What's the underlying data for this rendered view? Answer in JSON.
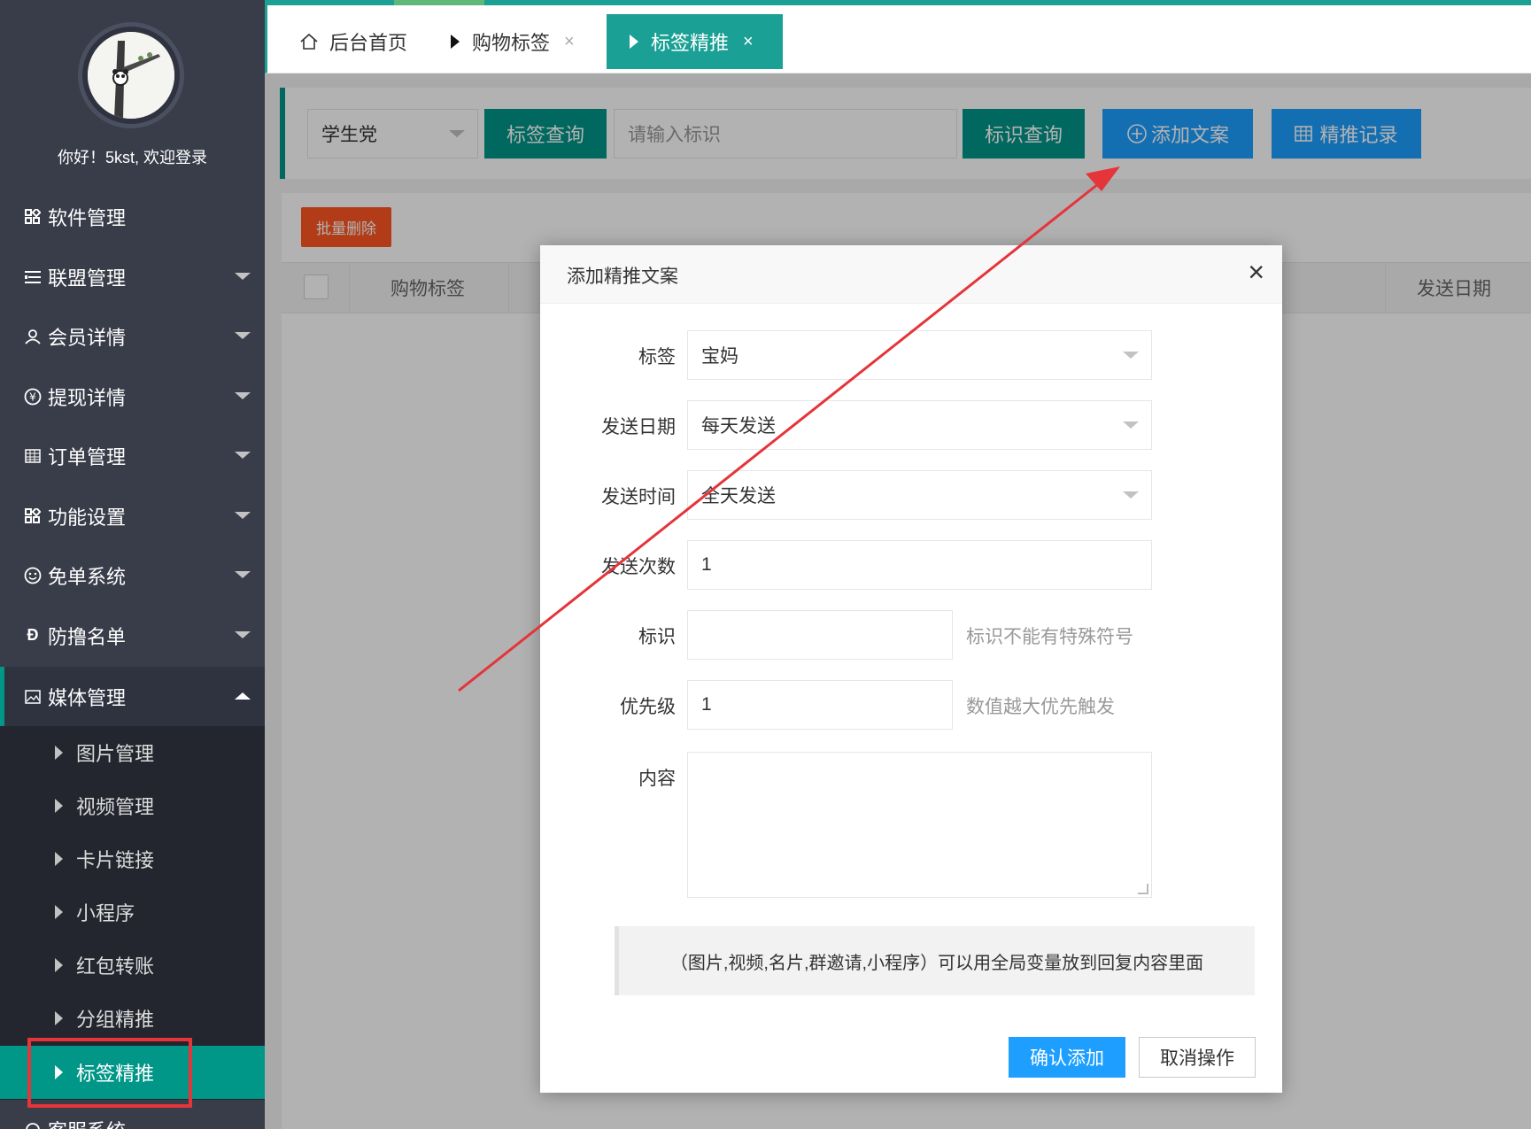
{
  "sidebar": {
    "welcome": "你好！5kst, 欢迎登录",
    "items": [
      {
        "label": "软件管理",
        "icon": "grid-icon"
      },
      {
        "label": "联盟管理",
        "icon": "list-icon"
      },
      {
        "label": "会员详情",
        "icon": "user-icon"
      },
      {
        "label": "提现详情",
        "icon": "yen-icon"
      },
      {
        "label": "订单管理",
        "icon": "table-icon"
      },
      {
        "label": "功能设置",
        "icon": "grid-icon"
      },
      {
        "label": "免单系统",
        "icon": "face-icon"
      },
      {
        "label": "防撸名单",
        "icon": "dong-icon"
      },
      {
        "label": "媒体管理",
        "icon": "picture-icon"
      }
    ],
    "submenu": [
      {
        "label": "图片管理"
      },
      {
        "label": "视频管理"
      },
      {
        "label": "卡片链接"
      },
      {
        "label": "小程序"
      },
      {
        "label": "红包转账"
      },
      {
        "label": "分组精推"
      },
      {
        "label": "标签精推"
      }
    ],
    "last_item": "客服系统"
  },
  "tabs": [
    {
      "label": "后台首页",
      "icon": "home-icon"
    },
    {
      "label": "购物标签",
      "close": "×"
    },
    {
      "label": "标签精推",
      "close": "×"
    }
  ],
  "search": {
    "select_value": "学生党",
    "tag_query": "标签查询",
    "id_placeholder": "请输入标识",
    "id_query": "标识查询",
    "add_copy": "添加文案",
    "records": "精推记录"
  },
  "table": {
    "batch_delete": "批量删除",
    "headers": [
      "购物标签",
      "发送日期"
    ]
  },
  "modal": {
    "title": "添加精推文案",
    "close": "×",
    "fields": {
      "tag_label": "标签",
      "tag_value": "宝妈",
      "date_label": "发送日期",
      "date_value": "每天发送",
      "time_label": "发送时间",
      "time_value": "全天发送",
      "count_label": "发送次数",
      "count_value": "1",
      "id_label": "标识",
      "id_value": "",
      "id_hint": "标识不能有特殊符号",
      "priority_label": "优先级",
      "priority_value": "1",
      "priority_hint": "数值越大优先触发",
      "content_label": "内容"
    },
    "notice": "（图片,视频,名片,群邀请,小程序）可以用全局变量放到回复内容里面",
    "confirm": "确认添加",
    "cancel": "取消操作"
  },
  "colors": {
    "sidebar": "#393d49",
    "accent": "#009688",
    "blue": "#1e9fff",
    "orange": "#ff5722",
    "annotation": "#e5343a"
  }
}
